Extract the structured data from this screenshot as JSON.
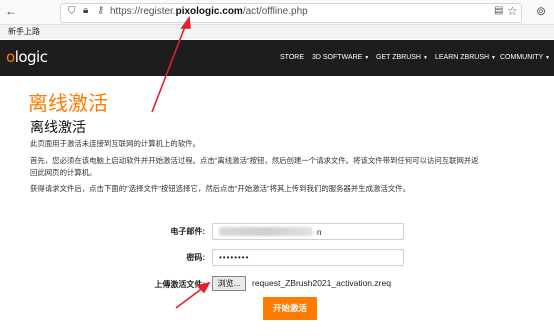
{
  "browser": {
    "url_prefix": "https://register.",
    "url_domain": "pixologic.com",
    "url_path": "/act/offline.php",
    "bookmark": "新手上路",
    "back_icon": "back-arrow-icon",
    "icons": [
      "shield-icon",
      "lock-icon",
      "key-icon",
      "reader-icon",
      "star-icon",
      "toolbar-icon"
    ]
  },
  "site": {
    "logo_prefix": "o",
    "logo_rest": "logic",
    "nav": [
      {
        "label": "STORE"
      },
      {
        "label": "3D SOFTWARE",
        "caret": "▼"
      },
      {
        "label": "GET ZBRUSH",
        "caret": "▼"
      },
      {
        "label": "LEARN ZBRUSH",
        "caret": "▼"
      },
      {
        "label": "COMMUNITY",
        "caret": "▼"
      }
    ]
  },
  "page": {
    "title": "离线激活",
    "subtitle": "离线激活",
    "para1": "此页面用于激活未连接到互联网的计算机上的软件。",
    "para2_line1": "首先，您必须在该电脑上启动软件并开始激活过程。点击\"离线激活\"按钮，然后创建一个请求文件。将该文件带到任何可以访问互联网并返",
    "para2_line2": "回此网页的计算机。",
    "para3": "获得请求文件后，点击下面的\"选择文件\"按钮选择它，然后点击\"开始激活\"将其上传到我们的服务器并生成激活文件。"
  },
  "form": {
    "email_label": "电子邮件:",
    "email_value_suffix": "n",
    "password_label": "密码:",
    "password_value": "••••••••",
    "upload_label": "上傳激活文件:",
    "browse_label": "浏览...",
    "file_name": "request_ZBrush2021_activation.zreq",
    "submit_label": "开始激活"
  },
  "colors": {
    "accent": "#ff7a00",
    "nav_bg": "#1d1d1d",
    "annotation_arrow": "#e0202c"
  }
}
